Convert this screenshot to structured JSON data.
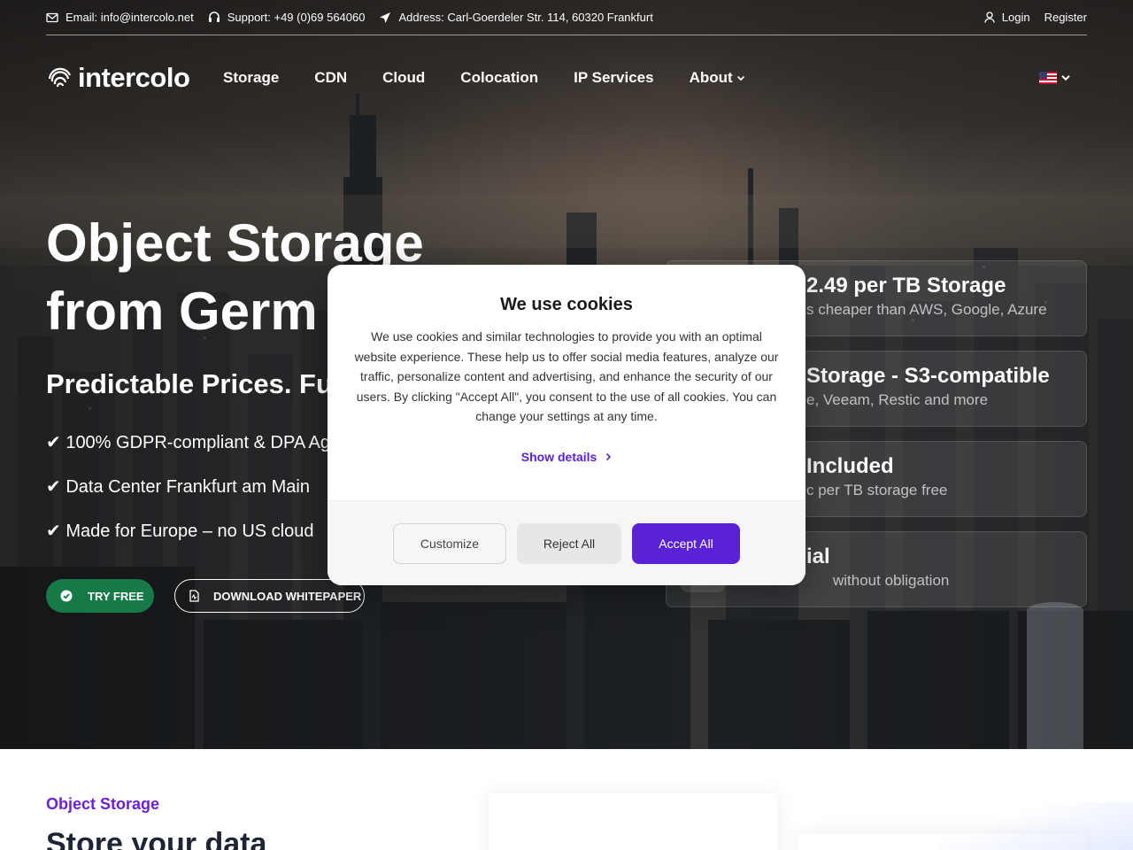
{
  "topbar": {
    "email": "Email: info@intercolo.net",
    "support": "Support: +49 (0)69 564060",
    "address": "Address: Carl-Goerdeler Str. 114, 60320 Frankfurt",
    "login": "Login",
    "register": "Register"
  },
  "nav": {
    "logo": "intercolo",
    "items": [
      "Storage",
      "CDN",
      "Cloud",
      "Colocation",
      "IP Services",
      "About"
    ]
  },
  "hero": {
    "title_line1": "Object Storage",
    "title_line2": "from Germ",
    "subtitle": "Predictable Prices. Fu",
    "checks": [
      "✔ 100% GDPR-compliant & DPA Agr",
      "✔ Data Center Frankfurt am Main",
      "✔ Made for Europe – no US cloud"
    ],
    "try_free": "TRY FREE",
    "download": "DOWNLOAD WHITEPAPER"
  },
  "features": [
    {
      "title": "2.49 per TB Storage",
      "sub": "s cheaper than AWS, Google, Azure"
    },
    {
      "title": "Storage - S3-compatible",
      "sub": "e, Veeam, Restic and more"
    },
    {
      "title": "Included",
      "sub": "c per TB storage free"
    },
    {
      "title": "ial",
      "sub": "without obligation"
    }
  ],
  "cookie": {
    "title": "We use cookies",
    "body": "We use cookies and similar technologies to provide you with an optimal website experience. These help us to offer social media features, analyze our traffic, personalize content and advertising, and enhance the security of our users. By clicking \"Accept All\", you consent to the use of all cookies. You can change your settings at any time.",
    "show_details": "Show details",
    "customize": "Customize",
    "reject": "Reject All",
    "accept": "Accept All"
  },
  "section": {
    "eyebrow": "Object Storage",
    "heading": "Store your data"
  },
  "colors": {
    "accent": "#5b21d6",
    "green": "#167a48",
    "eyebrow": "#6b21d6"
  }
}
